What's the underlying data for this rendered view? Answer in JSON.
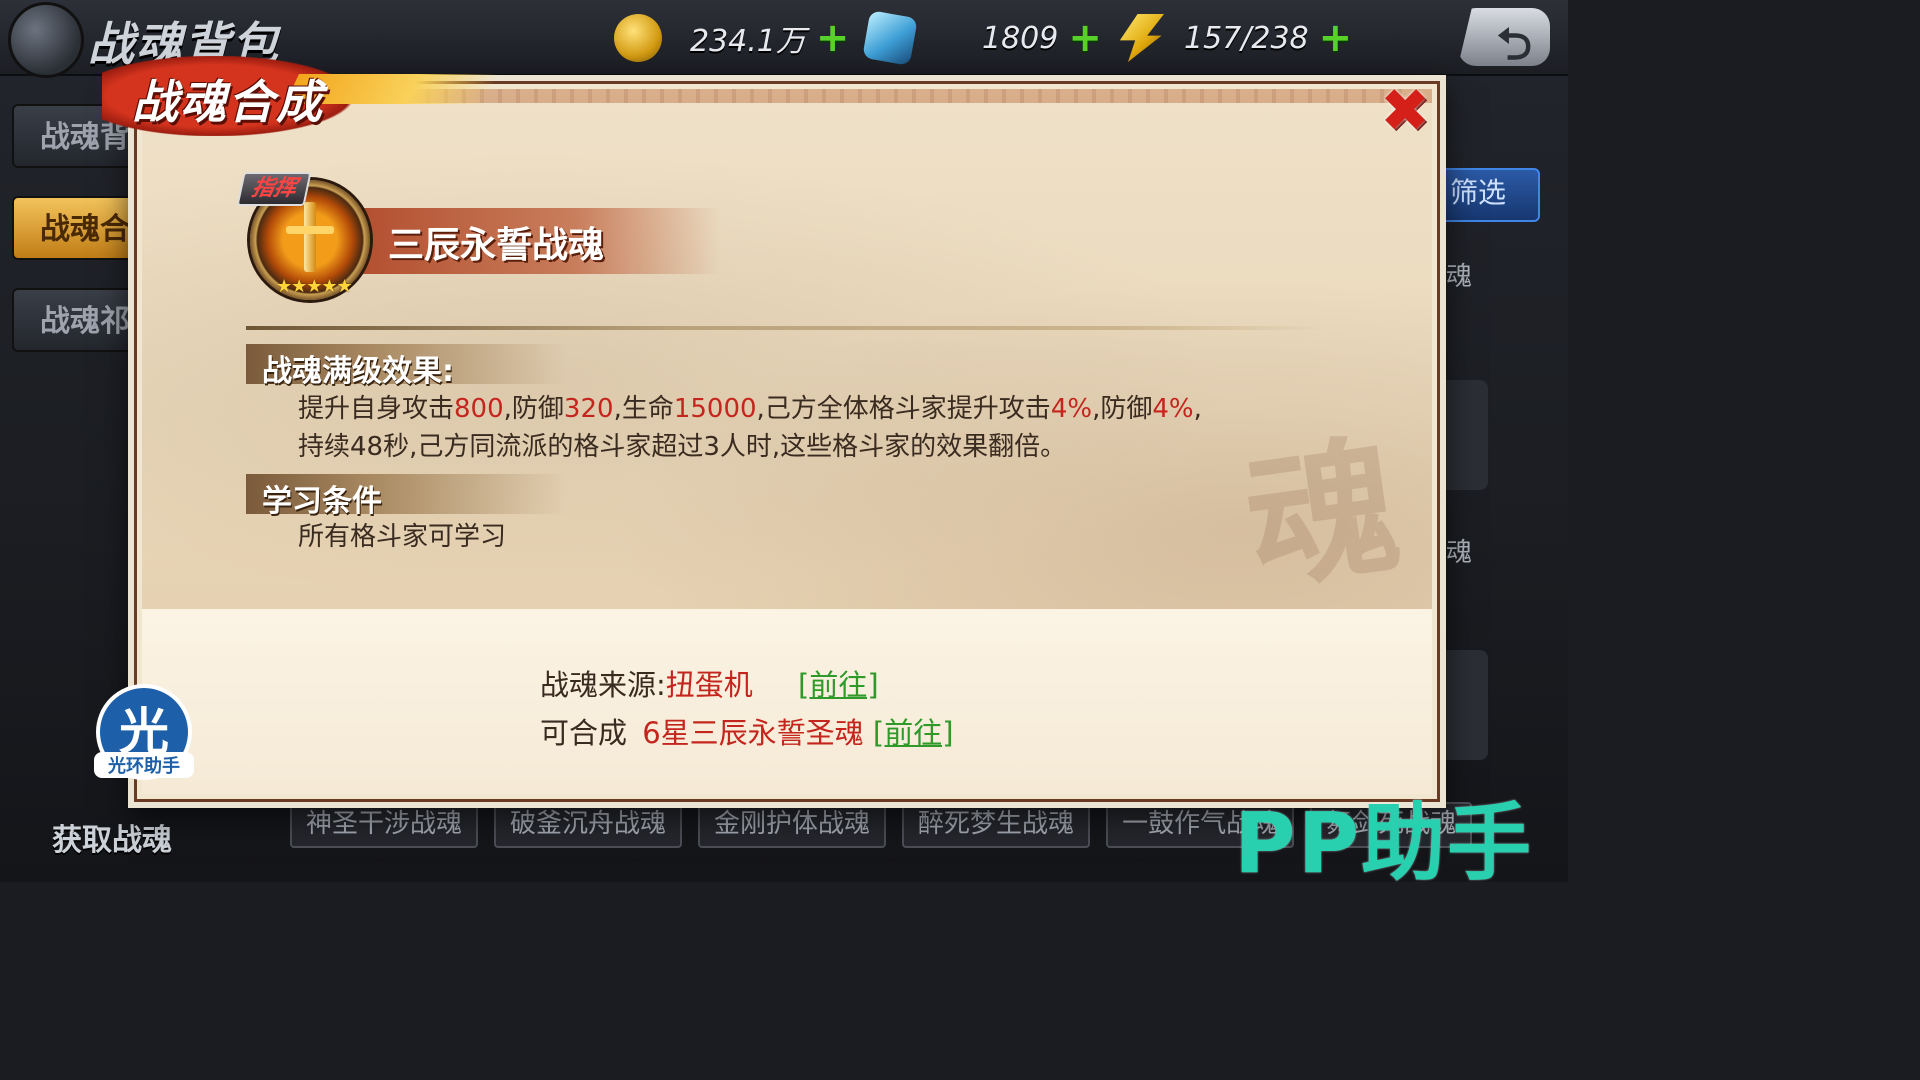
{
  "background": {
    "screen_title": "战魂背包",
    "resources": {
      "coins": "234.1万",
      "gems": "1809",
      "energy": "157/238",
      "plus": "+"
    },
    "side_tabs": [
      "战魂背",
      "战魂合",
      "战魂祁"
    ],
    "right_panel": {
      "filter_button": "筛选",
      "labels": [
        "魂",
        "魂"
      ]
    },
    "get_soul_label": "获取战魂",
    "bottom_tags": [
      "神圣干涉战魂",
      "破釜沉舟战魂",
      "金刚护体战魂",
      "醉死梦生战魂",
      "一鼓作气战魂",
      "舞剑死战魂"
    ]
  },
  "dialog": {
    "header_title": "战魂合成",
    "close_icon": "close-x-icon",
    "soul": {
      "category_tag": "指挥",
      "stars": "★★★★★",
      "name": "三辰永誓战魂"
    },
    "max_effect": {
      "title": "战魂满级效果:",
      "line1_parts": [
        "提升自身攻击",
        "800",
        ",防御",
        "320",
        ",生命",
        "15000",
        ",己方全体格斗家提升攻击",
        "4%",
        ",防御",
        "4%",
        ","
      ],
      "line2": "持续48秒,己方同流派的格斗家超过3人时,这些格斗家的效果翻倍。"
    },
    "learn_cond": {
      "title": "学习条件",
      "text": "所有格斗家可学习"
    },
    "source": {
      "label": "战魂来源:",
      "value": "扭蛋机",
      "goto": "[前往]"
    },
    "synth": {
      "label": "可合成",
      "value": "6星三辰永誓圣魂",
      "goto": "[前往]"
    },
    "ghost_char": "魂"
  },
  "watermarks": {
    "circle_big": "光",
    "circle_small": "光环助手",
    "pp": "PP助手"
  },
  "colors": {
    "highlight_red": "#c4261e",
    "link_green": "#2f9a2a",
    "plus_green": "#59d12b"
  }
}
